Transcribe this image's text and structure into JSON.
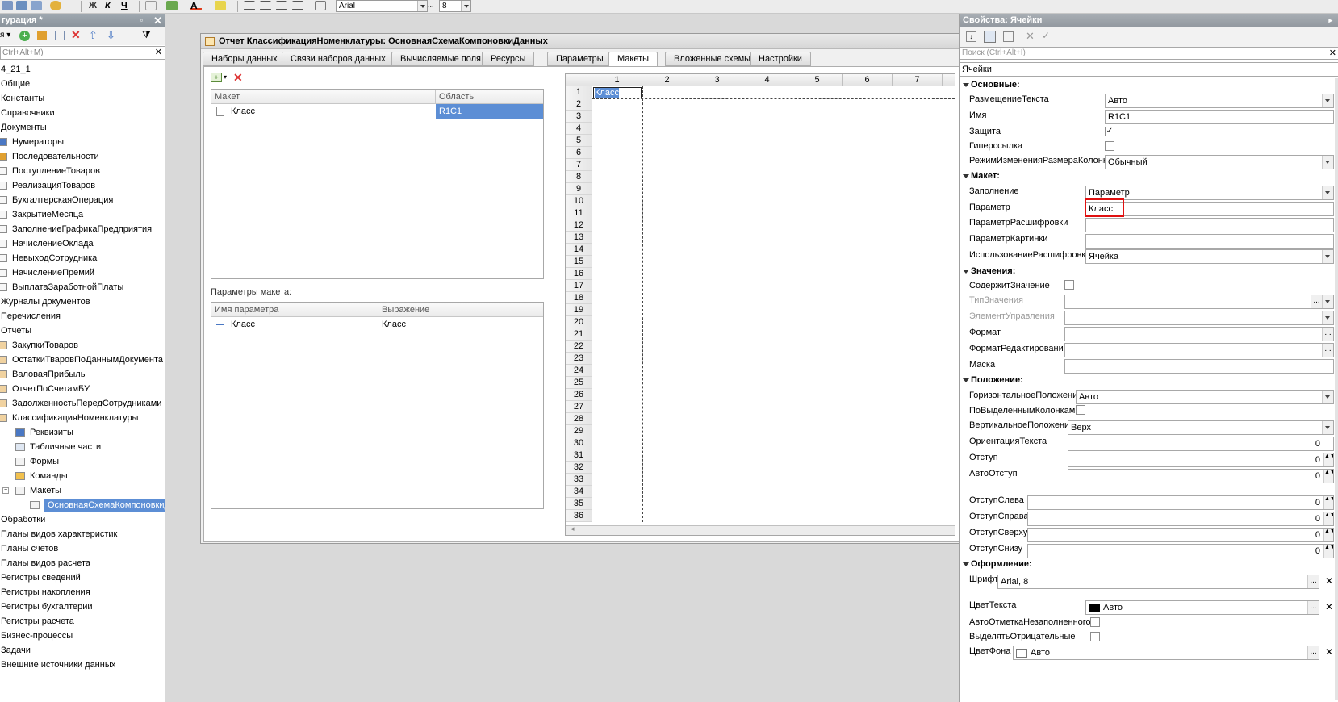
{
  "toolbar": {
    "font_name": "Arial",
    "font_size": "8"
  },
  "left_panel": {
    "title": "гурация *",
    "search_placeholder": "Ctrl+Alt+M)",
    "tree": [
      {
        "label": "4_21_1",
        "level": 0,
        "icon": "none"
      },
      {
        "label": "Общие",
        "level": 0,
        "icon": "none"
      },
      {
        "label": "Константы",
        "level": 0,
        "icon": "none"
      },
      {
        "label": "Справочники",
        "level": 0,
        "icon": "none"
      },
      {
        "label": "Документы",
        "level": 0,
        "icon": "none"
      },
      {
        "label": "Нумераторы",
        "level": 1,
        "icon": "numerator-icon"
      },
      {
        "label": "Последовательности",
        "level": 1,
        "icon": "sequence-icon"
      },
      {
        "label": "ПоступлениеТоваров",
        "level": 1,
        "icon": "document-icon"
      },
      {
        "label": "РеализацияТоваров",
        "level": 1,
        "icon": "document-icon"
      },
      {
        "label": "БухгалтерскаяОперация",
        "level": 1,
        "icon": "document-icon"
      },
      {
        "label": "ЗакрытиеМесяца",
        "level": 1,
        "icon": "document-icon"
      },
      {
        "label": "ЗаполнениеГрафикаПредприятия",
        "level": 1,
        "icon": "document-icon"
      },
      {
        "label": "НачислениеОклада",
        "level": 1,
        "icon": "document-icon"
      },
      {
        "label": "НевыходСотрудника",
        "level": 1,
        "icon": "document-icon"
      },
      {
        "label": "НачислениеПремий",
        "level": 1,
        "icon": "document-icon"
      },
      {
        "label": "ВыплатаЗаработнойПлаты",
        "level": 1,
        "icon": "document-icon"
      },
      {
        "label": "Журналы документов",
        "level": 0,
        "icon": "none"
      },
      {
        "label": "Перечисления",
        "level": 0,
        "icon": "none"
      },
      {
        "label": "Отчеты",
        "level": 0,
        "icon": "none"
      },
      {
        "label": "ЗакупкиТоваров",
        "level": 1,
        "icon": "report-icon"
      },
      {
        "label": "ОстаткиТваровПоДаннымДокумента",
        "level": 1,
        "icon": "report-icon"
      },
      {
        "label": "ВаловаяПрибыль",
        "level": 1,
        "icon": "report-icon"
      },
      {
        "label": "ОтчетПоСчетамБУ",
        "level": 1,
        "icon": "report-icon"
      },
      {
        "label": "ЗадолженностьПередСотрудниками",
        "level": 1,
        "icon": "report-icon"
      },
      {
        "label": "КлассификацияНоменклатуры",
        "level": 1,
        "icon": "report-icon"
      },
      {
        "label": "Реквизиты",
        "level": 2,
        "icon": "attribute-icon"
      },
      {
        "label": "Табличные части",
        "level": 2,
        "icon": "table-icon"
      },
      {
        "label": "Формы",
        "level": 2,
        "icon": "form-icon"
      },
      {
        "label": "Команды",
        "level": 2,
        "icon": "command-icon"
      },
      {
        "label": "Макеты",
        "level": 2,
        "icon": "template-icon"
      },
      {
        "label": "ОсновнаяСхемаКомпоновкиДанных",
        "level": 3,
        "icon": "template-icon",
        "selected": true
      },
      {
        "label": "Обработки",
        "level": 0,
        "icon": "none"
      },
      {
        "label": "Планы видов характеристик",
        "level": 0,
        "icon": "none"
      },
      {
        "label": "Планы счетов",
        "level": 0,
        "icon": "none"
      },
      {
        "label": "Планы видов расчета",
        "level": 0,
        "icon": "none"
      },
      {
        "label": "Регистры сведений",
        "level": 0,
        "icon": "none"
      },
      {
        "label": "Регистры накопления",
        "level": 0,
        "icon": "none"
      },
      {
        "label": "Регистры бухгалтерии",
        "level": 0,
        "icon": "none"
      },
      {
        "label": "Регистры расчета",
        "level": 0,
        "icon": "none"
      },
      {
        "label": "Бизнес-процессы",
        "level": 0,
        "icon": "none"
      },
      {
        "label": "Задачи",
        "level": 0,
        "icon": "none"
      },
      {
        "label": "Внешние источники данных",
        "level": 0,
        "icon": "none"
      }
    ]
  },
  "window": {
    "title": "Отчет КлассификацияНоменклатуры: ОсновнаяСхемаКомпоновкиДанных",
    "tabs": [
      "Наборы данных",
      "Связи наборов данных",
      "Вычисляемые поля",
      "Ресурсы",
      "Параметры",
      "Макеты",
      "Вложенные схемы",
      "Настройки"
    ],
    "active_tab": "Макеты"
  },
  "layouts_table": {
    "columns": [
      "Макет",
      "Область"
    ],
    "rows": [
      {
        "name": "Класс",
        "area": "R1C1"
      }
    ]
  },
  "params_section": {
    "label": "Параметры макета:",
    "columns": [
      "Имя параметра",
      "Выражение"
    ],
    "rows": [
      {
        "name": "Класс",
        "expression": "Класс"
      }
    ]
  },
  "sheet": {
    "columns": [
      "1",
      "2",
      "3",
      "4",
      "5",
      "6",
      "7"
    ],
    "rows": [
      "1",
      "2",
      "3",
      "4",
      "5",
      "6",
      "7",
      "8",
      "9",
      "10",
      "11",
      "12",
      "13",
      "14",
      "15",
      "16",
      "17",
      "18",
      "19",
      "20",
      "21",
      "22",
      "23",
      "24",
      "25",
      "26",
      "27",
      "28",
      "29",
      "30",
      "31",
      "32",
      "33",
      "34",
      "35",
      "36"
    ],
    "cell_r1c1": "Класс"
  },
  "properties": {
    "title": "Свойства: Ячейки",
    "search_placeholder": "Поиск (Ctrl+Alt+I)",
    "object": "Ячейки",
    "sections": {
      "basic": "Основные:",
      "template": "Макет:",
      "values": "Значения:",
      "position": "Положение:",
      "design": "Оформление:"
    },
    "labels": {
      "text_placement": "РазмещениеТекста",
      "name": "Имя",
      "protection": "Защита",
      "hyperlink": "Гиперссылка",
      "column_resize_mode": "РежимИзмененияРазмераКолонки",
      "fill": "Заполнение",
      "parameter": "Параметр",
      "details_parameter": "ПараметрРасшифровки",
      "picture_parameter": "ПараметрКартинки",
      "details_usage": "ИспользованиеРасшифровки",
      "contains_value": "СодержитЗначение",
      "value_type": "ТипЗначения",
      "control": "ЭлементУправления",
      "format": "Формат",
      "edit_format": "ФорматРедактирования",
      "mask": "Маска",
      "horizontal_position": "ГоризонтальноеПоложение",
      "by_selected_columns": "ПоВыделеннымКолонкам",
      "vertical_position": "ВертикальноеПоложение",
      "text_orientation": "ОриентацияТекста",
      "indent": "Отступ",
      "auto_indent": "АвтоОтступ",
      "indent_left": "ОтступСлева",
      "indent_right": "ОтступСправа",
      "indent_top": "ОтступСверху",
      "indent_bottom": "ОтступСнизу",
      "font": "Шрифт",
      "text_color": "ЦветТекста",
      "auto_mark_empty": "АвтоОтметкаНезаполненного",
      "highlight_negative": "ВыделятьОтрицательные",
      "back_color": "ЦветФона"
    },
    "values": {
      "text_placement": "Авто",
      "name": "R1C1",
      "column_resize_mode": "Обычный",
      "fill": "Параметр",
      "parameter": "Класс",
      "details_usage": "Ячейка",
      "horizontal_position": "Авто",
      "vertical_position": "Верх",
      "text_orientation": "0",
      "indent": "0",
      "auto_indent": "0",
      "indent_left": "0",
      "indent_right": "0",
      "indent_top": "0",
      "indent_bottom": "0",
      "font": "Arial, 8",
      "text_color": "Авто",
      "back_color": "Авто"
    },
    "checks": {
      "protection": true,
      "hyperlink": false,
      "contains_value": false,
      "by_selected_columns": false,
      "auto_mark_empty": false,
      "highlight_negative": false
    }
  },
  "colors": {
    "selection": "#5c8ed5",
    "highlight_border": "#e01010",
    "panel_title": "#92989f"
  }
}
